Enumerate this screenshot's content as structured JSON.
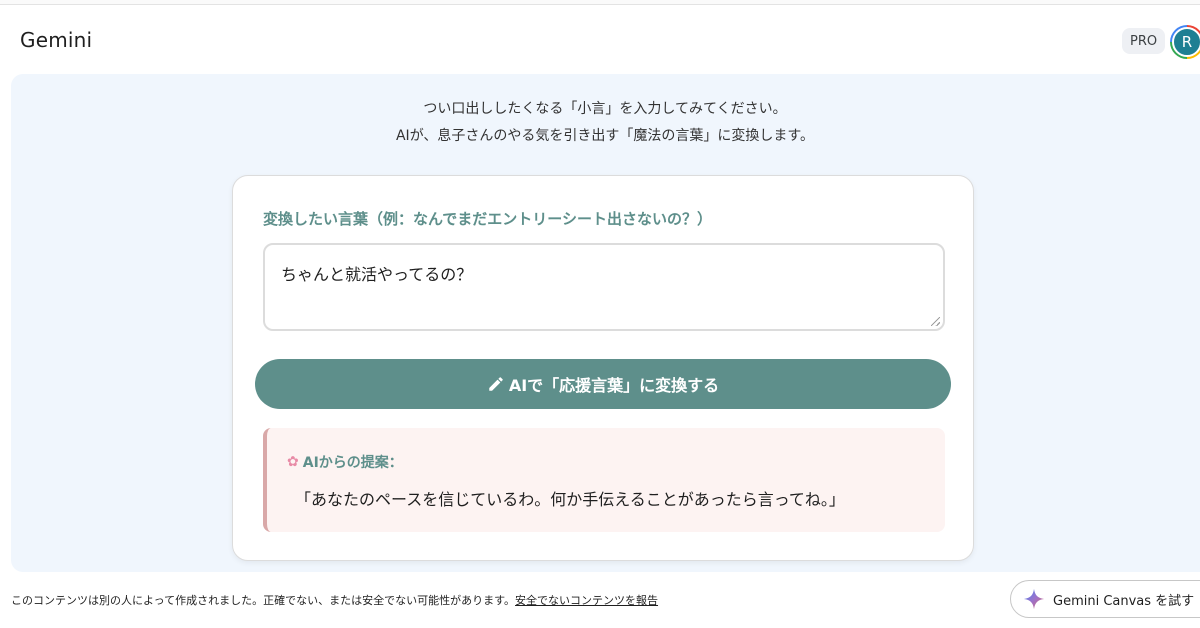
{
  "header": {
    "brand": "Gemini",
    "pro_badge": "PRO",
    "avatar_letter": "R"
  },
  "app": {
    "intro_line1": "つい口出ししたくなる「小言」を入力してみてください。",
    "intro_line2": "AIが、息子さんのやる気を引き出す「魔法の言葉」に変換します。",
    "field_label": "変換したい言葉（例：なんでまだエントリーシート出さないの？）",
    "input_value": "ちゃんと就活やってるの？",
    "convert_button": "AIで「応援言葉」に変換する",
    "result_label": "AIからの提案：",
    "result_text": "「あなたのペースを信じているわ。何か手伝えることがあったら言ってね。」"
  },
  "footer": {
    "note": "このコンテンツは別の人によって作成されました。正確でない、または安全でない可能性があります。",
    "report_link": "安全でないコンテンツを報告",
    "canvas_button": "Gemini Canvas を試す"
  },
  "colors": {
    "accent": "#5e8f8b",
    "canvas_bg": "#f0f6fd",
    "result_bg": "#fdf3f2"
  },
  "icons": [
    "pencil-icon",
    "flower-icon",
    "sparkle-icon"
  ]
}
